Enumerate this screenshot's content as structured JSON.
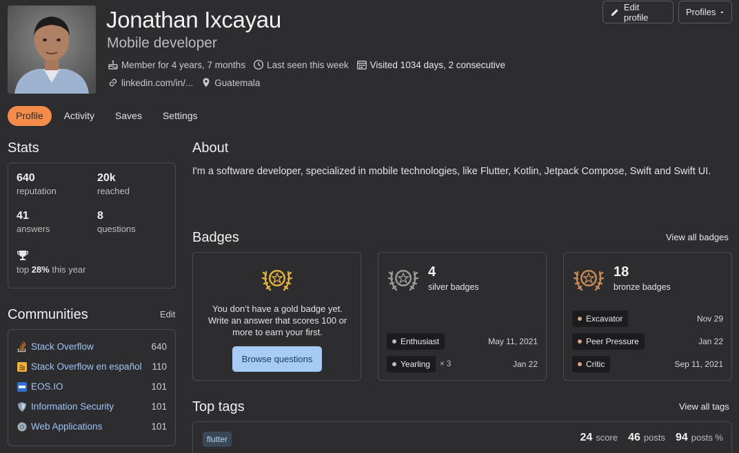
{
  "profile": {
    "name": "Jonathan Ixcayau",
    "title": "Mobile developer",
    "member_for": "Member for 4 years, 7 months",
    "last_seen": "Last seen this week",
    "visited": "Visited 1034 days, 2 consecutive",
    "website": "linkedin.com/in/...",
    "location": "Guatemala"
  },
  "header_buttons": {
    "edit_profile": "Edit profile",
    "profiles": "Profiles"
  },
  "nav": {
    "tabs": [
      {
        "label": "Profile",
        "active": true
      },
      {
        "label": "Activity",
        "active": false
      },
      {
        "label": "Saves",
        "active": false
      },
      {
        "label": "Settings",
        "active": false
      }
    ]
  },
  "stats": {
    "heading": "Stats",
    "reputation": {
      "value": "640",
      "label": "reputation"
    },
    "reached": {
      "value": "20k",
      "label": "reached"
    },
    "answers": {
      "value": "41",
      "label": "answers"
    },
    "questions": {
      "value": "8",
      "label": "questions"
    },
    "top_prefix": "top",
    "top_value": "28%",
    "top_suffix": "this year"
  },
  "communities": {
    "heading": "Communities",
    "edit_label": "Edit",
    "items": [
      {
        "name": "Stack Overflow",
        "value": "640",
        "icon": "stackoverflow-icon"
      },
      {
        "name": "Stack Overflow en español",
        "value": "110",
        "icon": "stackoverflow-es-icon"
      },
      {
        "name": "EOS.IO",
        "value": "101",
        "icon": "eos-icon"
      },
      {
        "name": "Information Security",
        "value": "101",
        "icon": "security-shield-icon"
      },
      {
        "name": "Web Applications",
        "value": "101",
        "icon": "webapps-icon"
      }
    ]
  },
  "about": {
    "heading": "About",
    "text": "I'm a software developer, specialized in mobile technologies, like Flutter, Kotlin, Jetpack Compose, Swift and Swift UI."
  },
  "badges": {
    "heading": "Badges",
    "view_all": "View all badges",
    "gold": {
      "message": "You don’t have a gold badge yet. Write an answer that scores 100 or more to earn your first.",
      "button": "Browse questions"
    },
    "silver": {
      "count": "4",
      "label": "silver badges",
      "items": [
        {
          "name": "Enthusiast",
          "date": "May 11, 2021",
          "multiplier": ""
        },
        {
          "name": "Yearling",
          "date": "Jan 22",
          "multiplier": "× 3"
        }
      ]
    },
    "bronze": {
      "count": "18",
      "label": "bronze badges",
      "items": [
        {
          "name": "Excavator",
          "date": "Nov 29"
        },
        {
          "name": "Peer Pressure",
          "date": "Jan 22"
        },
        {
          "name": "Critic",
          "date": "Sep 11, 2021"
        }
      ]
    }
  },
  "colors": {
    "accent": "#f48c4a",
    "gold": "#e5b33c",
    "silver": "#9a9a9a",
    "bronze": "#c98a55",
    "link": "#9fc3f5"
  },
  "top_tags": {
    "heading": "Top tags",
    "view_all": "View all tags",
    "items": [
      {
        "tag": "flutter",
        "score": "24",
        "score_label": "score",
        "posts": "46",
        "posts_label": "posts",
        "posts_pct": "94",
        "posts_pct_label": "posts %"
      }
    ]
  }
}
